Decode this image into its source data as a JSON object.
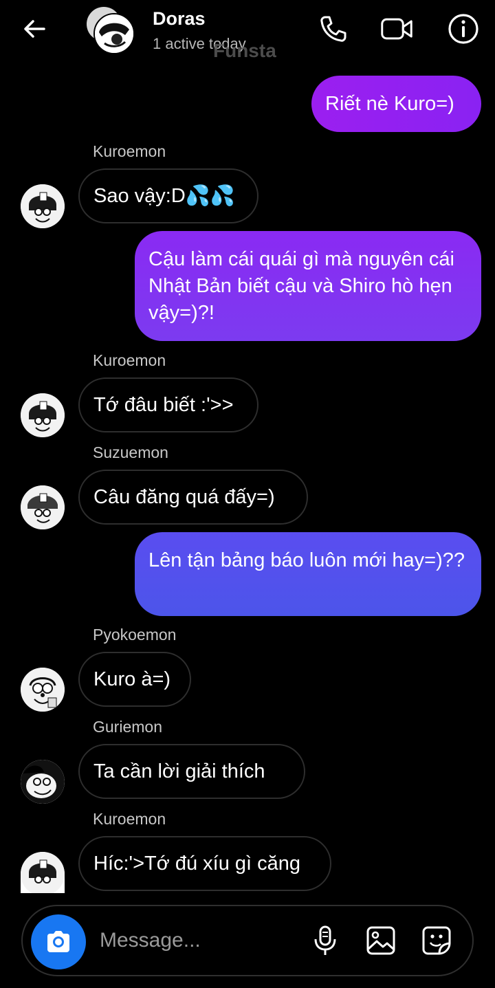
{
  "header": {
    "name": "Doras",
    "status": "1 active today",
    "watermark": "Funsta"
  },
  "messages": {
    "m1": {
      "text": "Riết nè Kuro=)"
    },
    "m2": {
      "sender": "Kuroemon",
      "text": "Sao vậy:D💦💦"
    },
    "m3": {
      "text": "Cậu làm cái quái gì mà nguyên cái Nhật Bản biết cậu và Shiro hò hẹn vậy=)?!"
    },
    "m4": {
      "sender": "Kuroemon",
      "text": "Tớ đâu biết :'>>"
    },
    "m5": {
      "sender": "Suzuemon",
      "text": "Câu đăng quá đấy=)"
    },
    "m6": {
      "text": "Lên tận bảng báo luôn mới hay=)??"
    },
    "m7": {
      "sender": "Pyokoemon",
      "text": "Kuro à=)"
    },
    "m8": {
      "sender": "Guriemon",
      "text": "Ta cần lời giải thích"
    },
    "m9": {
      "sender": "Kuroemon",
      "text": "Híc:'>Tớ đú xíu gì căng"
    }
  },
  "composer": {
    "placeholder": "Message..."
  },
  "colors": {
    "outgoing_top": "#9b1ff0",
    "outgoing_mid": "#7c3bf0",
    "outgoing_bottom": "#4c55ea",
    "camera_button": "#1877f2"
  },
  "icons": [
    "back-arrow-icon",
    "phone-icon",
    "video-camera-icon",
    "info-icon",
    "camera-icon",
    "microphone-icon",
    "image-icon",
    "sticker-icon"
  ]
}
